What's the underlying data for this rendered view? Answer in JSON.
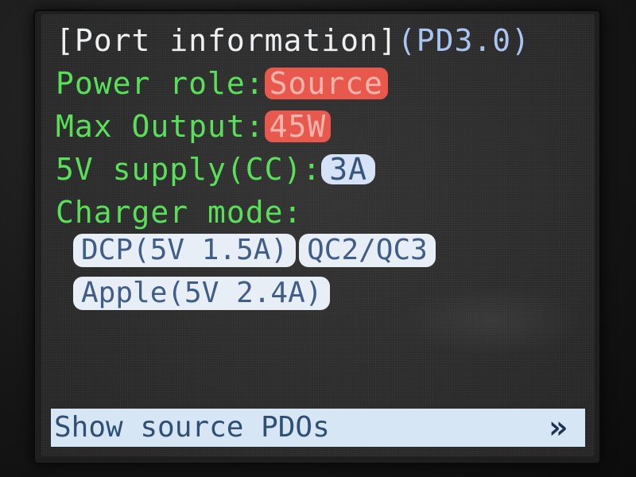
{
  "header": {
    "title": "[Port information]",
    "protocol": "(PD3.0)"
  },
  "power_role": {
    "label": "Power role:",
    "value": "Source"
  },
  "max_output": {
    "label": "Max Output:",
    "value": "45W"
  },
  "supply_5v": {
    "label": "5V supply(CC):",
    "value": "3A"
  },
  "charger_mode": {
    "label": "Charger mode:",
    "modes": [
      "DCP(5V 1.5A)",
      "QC2/QC3",
      "Apple(5V 2.4A)"
    ]
  },
  "bottom_bar": {
    "label": "Show source PDOs",
    "arrow": "»"
  },
  "colors": {
    "title": "#eef0f2",
    "protocol": "#a9c6f2",
    "labels": "#58e058",
    "highlight_red": "#e9584c",
    "highlight_blue": "#d6e2f5",
    "bottom_bar": "#d7e6f4"
  }
}
